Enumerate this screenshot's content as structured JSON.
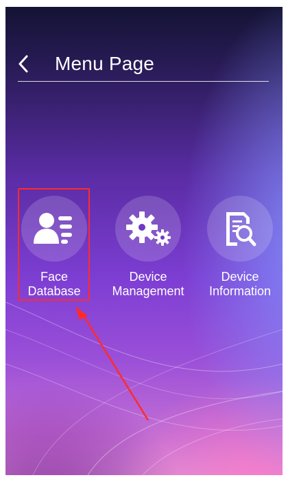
{
  "header": {
    "back_icon": "chevron-left-icon",
    "title": "Menu Page"
  },
  "menu": {
    "items": [
      {
        "label_line1": "Face",
        "label_line2": "Database",
        "icon": "face-database-icon"
      },
      {
        "label_line1": "Device",
        "label_line2": "Management",
        "icon": "gears-icon"
      },
      {
        "label_line1": "Device",
        "label_line2": "Information",
        "icon": "document-search-icon"
      }
    ]
  },
  "annotation": {
    "highlight_color": "#ff2b2b",
    "arrow_color": "#ff2b2b"
  }
}
